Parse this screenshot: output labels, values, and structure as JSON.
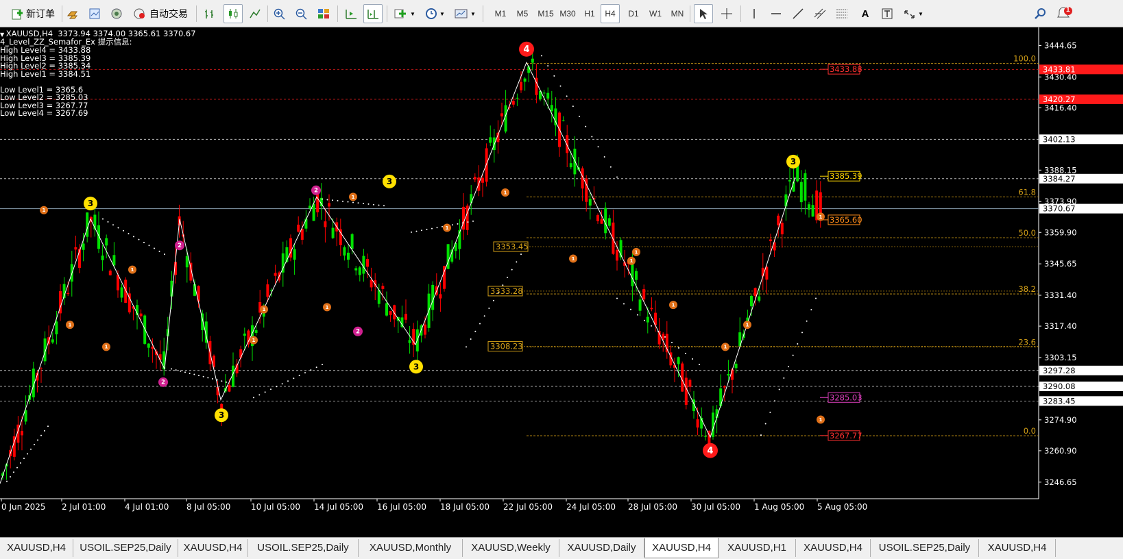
{
  "toolbar": {
    "new_order": "新订单",
    "auto_trading": "自动交易",
    "timeframes": [
      "M1",
      "M5",
      "M15",
      "M30",
      "H1",
      "H4",
      "D1",
      "W1",
      "MN"
    ],
    "active_timeframe": "H4",
    "text_tool": "A",
    "notification_badge": "1"
  },
  "chart_info": {
    "header": "XAUUSD,H4  3373.94 3374.00 3365.61 3370.67",
    "indicator": "4_Level_ZZ_Semafor_Ex 提示信息:",
    "high_levels": [
      "High Level4 = 3433.88",
      "High Level3 = 3385.39",
      "High Level2 = 3385.34",
      "High Level1 = 3384.51"
    ],
    "low_levels": [
      "Low Level1 = 3365.6",
      "Low Level2 = 3285.03",
      "Low Level3 = 3267.77",
      "Low Level4 = 3267.69"
    ]
  },
  "chart_data": {
    "type": "candlestick",
    "symbol": "XAUUSD",
    "timeframe": "H4",
    "ylim": [
      3241,
      3451
    ],
    "price_ticks": [
      3444.65,
      3430.4,
      3416.4,
      3388.15,
      3373.9,
      3359.9,
      3345.65,
      3331.4,
      3317.4,
      3303.15,
      3290.08,
      3274.9,
      3260.9,
      3246.65
    ],
    "time_labels": [
      "0 Jun 2025",
      "2 Jul 01:00",
      "4 Jul 01:00",
      "8 Jul 05:00",
      "10 Jul 05:00",
      "14 Jul 05:00",
      "16 Jul 05:00",
      "18 Jul 05:00",
      "22 Jul 05:00",
      "24 Jul 05:00",
      "28 Jul 05:00",
      "30 Jul 05:00",
      "1 Aug 05:00",
      "5 Aug 05:00"
    ],
    "current_price": 3370.67,
    "colors": {
      "bull": "#00e000",
      "bear": "#ff0000",
      "background": "#000000",
      "zigzag": "#ffffff",
      "fibo": "#d4a017"
    },
    "horizontal_levels": [
      {
        "price": 3433.81,
        "label": "3433.81",
        "color": "#ff2020"
      },
      {
        "price": 3420.27,
        "label": "3420.27",
        "color": "#ff2020"
      },
      {
        "price": 3402.13,
        "label": "3402.13",
        "color": "#ffffff"
      },
      {
        "price": 3384.27,
        "label": "3384.27",
        "color": "#ffffff"
      },
      {
        "price": 3297.28,
        "label": "3297.28",
        "color": "#ffffff"
      },
      {
        "price": 3290.08,
        "label": "3290.08",
        "color": "#ffffff"
      },
      {
        "price": 3283.45,
        "label": "3283.45",
        "color": "#ffffff"
      }
    ],
    "semafor_labels": [
      {
        "price": 3433.88,
        "label": "3433.88",
        "color": "#ff3030"
      },
      {
        "price": 3385.39,
        "label": "3385.39",
        "color": "#ffd700"
      },
      {
        "price": 3365.6,
        "label": "3365.60",
        "color": "#ff8c1a"
      },
      {
        "price": 3285.03,
        "label": "3285.03",
        "color": "#e040c0"
      },
      {
        "price": 3267.77,
        "label": "3267.77",
        "color": "#ff3030"
      }
    ],
    "fibo_levels": [
      {
        "name": "100.0",
        "price": 3436.5
      },
      {
        "name": "61.8",
        "price": 3376.0
      },
      {
        "name": "50.0",
        "price": 3357.5
      },
      {
        "name": "38.2",
        "price": 3332.0
      },
      {
        "name": "23.6",
        "price": 3308.0
      },
      {
        "name": "0.0",
        "price": 3267.7
      }
    ],
    "price_boxes": [
      {
        "price": 3353.45,
        "label": "3353.45"
      },
      {
        "price": 3333.28,
        "label": "3333.28"
      },
      {
        "price": 3308.23,
        "label": "3308.23"
      }
    ],
    "zigzag_prices": [
      3246,
      3366,
      3298,
      3366,
      3284,
      3376,
      3309,
      3437,
      3267,
      3385
    ],
    "semafor_points": [
      {
        "price": 3373,
        "label": "3"
      },
      {
        "price": 3370,
        "label": "1"
      },
      {
        "price": 3318,
        "label": "1"
      },
      {
        "price": 3308,
        "label": "1"
      },
      {
        "price": 3343,
        "label": "1"
      },
      {
        "price": 3354,
        "label": "2"
      },
      {
        "price": 3292,
        "label": "2"
      },
      {
        "price": 3277,
        "label": "3"
      },
      {
        "price": 3311,
        "label": "1"
      },
      {
        "price": 3325,
        "label": "1"
      },
      {
        "price": 3379,
        "label": "2"
      },
      {
        "price": 3376,
        "label": "1"
      },
      {
        "price": 3326,
        "label": "1"
      },
      {
        "price": 3315,
        "label": "2"
      },
      {
        "price": 3383,
        "label": "3"
      },
      {
        "price": 3299,
        "label": "3"
      },
      {
        "price": 3362,
        "label": "1"
      },
      {
        "price": 3378,
        "label": "1"
      },
      {
        "price": 3443,
        "label": "4"
      },
      {
        "price": 3348,
        "label": "1"
      },
      {
        "price": 3347,
        "label": "1"
      },
      {
        "price": 3351,
        "label": "1"
      },
      {
        "price": 3327,
        "label": "1"
      },
      {
        "price": 3308,
        "label": "1"
      },
      {
        "price": 3318,
        "label": "1"
      },
      {
        "price": 3261,
        "label": "4"
      },
      {
        "price": 3275,
        "label": "1"
      },
      {
        "price": 3392,
        "label": "3"
      },
      {
        "price": 3367,
        "label": "1"
      }
    ]
  },
  "tabs": [
    "XAUUSD,H4",
    "USOIL.SEP25,Daily",
    "XAUUSD,H4",
    "USOIL.SEP25,Daily",
    "XAUUSD,Monthly",
    "XAUUSD,Weekly",
    "XAUUSD,Daily",
    "XAUUSD,H4",
    "XAUUSD,H1",
    "XAUUSD,H4",
    "USOIL.SEP25,Daily",
    "XAUUSD,H4"
  ],
  "active_tab_index": 7
}
